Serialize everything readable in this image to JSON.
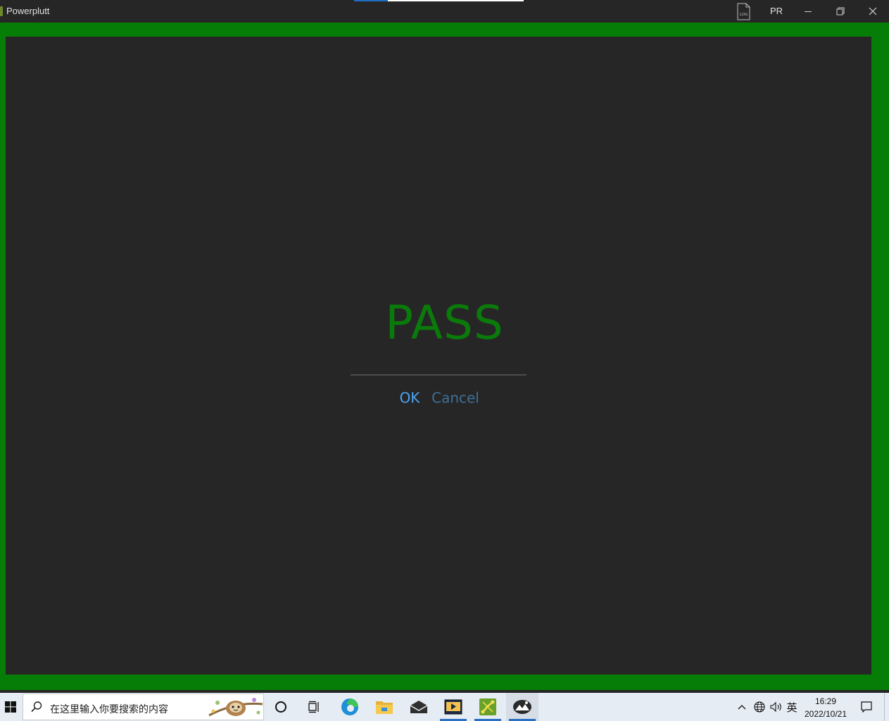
{
  "window": {
    "title": "Powerplutt",
    "progress_fraction": 0.2,
    "log_icon_text": "LOG",
    "pr_label": "PR"
  },
  "dialog": {
    "result": "PASS",
    "ok_label": "OK",
    "cancel_label": "Cancel"
  },
  "taskbar": {
    "search_placeholder": "在这里输入你要搜索的内容",
    "apps": [
      "cortana-icon",
      "task-view-icon",
      "edge-icon",
      "file-explorer-icon",
      "mail-icon",
      "video-app-icon",
      "green-app-icon",
      "photos-app-icon"
    ],
    "tray": {
      "ime": "英",
      "time": "16:29",
      "date": "2022/10/21"
    }
  },
  "colors": {
    "frame_green": "#067d06",
    "pass_green": "#0a7a0a",
    "ok_blue": "#4ba3f0",
    "cancel_blue": "#3f6f95",
    "background": "#262626"
  }
}
